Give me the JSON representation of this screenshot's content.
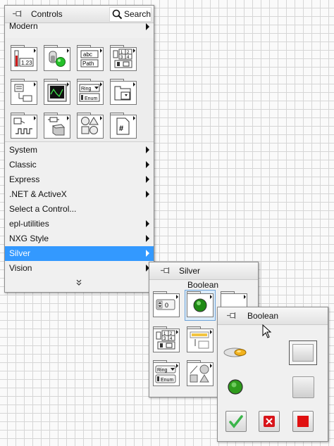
{
  "controls_palette": {
    "title": "Controls",
    "search_label": "Search",
    "section": "Modern",
    "categories": [
      {
        "label": "System",
        "has_submenu": true
      },
      {
        "label": "Classic",
        "has_submenu": true
      },
      {
        "label": "Express",
        "has_submenu": true
      },
      {
        "label": ".NET & ActiveX",
        "has_submenu": true
      },
      {
        "label": "Select a Control...",
        "has_submenu": false
      },
      {
        "label": "epl-utilities",
        "has_submenu": true
      },
      {
        "label": "NXG Style",
        "has_submenu": true
      },
      {
        "label": "Silver",
        "has_submenu": true,
        "selected": true
      },
      {
        "label": "Vision",
        "has_submenu": true
      }
    ],
    "modern_icons": {
      "numeric_value": "1.23",
      "string_top": "abc",
      "string_bottom": "Path",
      "array_cells": [
        "1",
        "2",
        "3",
        "4"
      ],
      "ring_label": "Ring",
      "enum_label": "Enum",
      "refnum_label": "#"
    },
    "expand_icon": "double-chevron-down-icon",
    "selection_color": "#3399ff"
  },
  "silver_palette": {
    "title": "Silver",
    "subtitle": "Boolean",
    "numeric_value": "0",
    "array_cells": [
      "1",
      "2",
      "3",
      "4"
    ],
    "ring_label": "Ring",
    "enum_label": "Enum"
  },
  "boolean_palette": {
    "title": "Boolean",
    "led_color": "#2e9b1c",
    "ok_color": "#3bb54a",
    "cancel_color": "#d8141a",
    "stop_color": "#e01010"
  }
}
